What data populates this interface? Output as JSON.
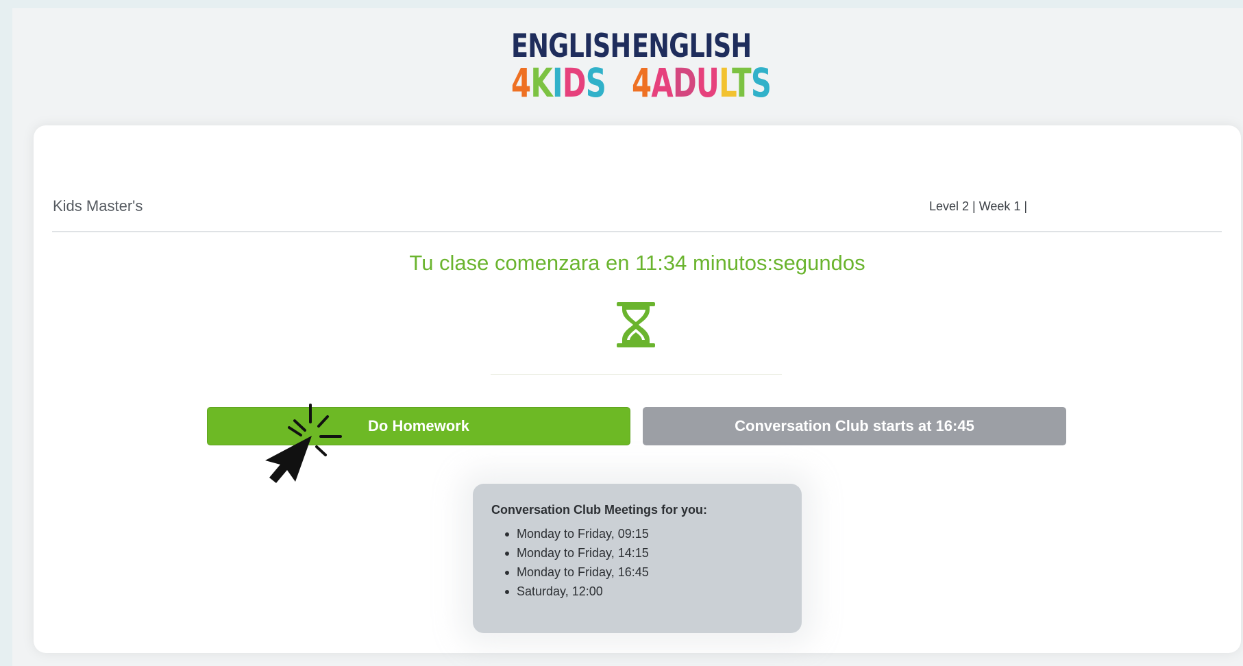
{
  "logos": {
    "kids": {
      "line1": "ENGLISH",
      "line2": "4KIDS"
    },
    "adults": {
      "line1": "ENGLISH",
      "line2": "4ADULTS"
    }
  },
  "header": {
    "course_title": "Kids Master's",
    "level_info": "Level 2 | Week 1 |"
  },
  "countdown": {
    "text": "Tu clase comenzara en 11:34 minutos:segundos",
    "icon": "hourglass-icon",
    "color": "#6ab42e"
  },
  "buttons": {
    "homework": "Do Homework",
    "club": "Conversation Club starts at 16:45"
  },
  "meetings": {
    "title": "Conversation Club Meetings for you:",
    "items": [
      "Monday to Friday, 09:15",
      "Monday to Friday, 14:15",
      "Monday to Friday, 16:45",
      "Saturday, 12:00"
    ]
  },
  "colors": {
    "accent_green": "#6db925",
    "disabled_gray": "#9c9fa5",
    "panel_gray": "#cbd0d5"
  },
  "cursor": {
    "icon": "pointer-click-icon"
  }
}
